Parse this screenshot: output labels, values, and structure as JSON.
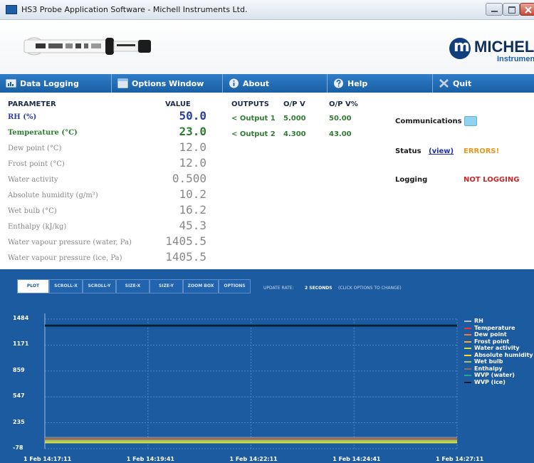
{
  "window": {
    "title": "HS3 Probe Application Software - Michell Instruments Ltd."
  },
  "brand": {
    "name": "MICHELL",
    "sub": "Instruments"
  },
  "menu": [
    {
      "label": "Data Logging",
      "icon": "data-logging-icon"
    },
    {
      "label": "Options Window",
      "icon": "options-window-icon"
    },
    {
      "label": "About",
      "icon": "info-icon"
    },
    {
      "label": "Help",
      "icon": "help-icon"
    },
    {
      "label": "Quit",
      "icon": "quit-icon"
    }
  ],
  "table": {
    "headers": {
      "parameter": "PARAMETER",
      "value": "VALUE",
      "outputs": "OUTPUTS",
      "opv": "O/P V",
      "opvp": "O/P V%"
    },
    "rows": [
      {
        "name": "RH (%)",
        "value": "50.0",
        "color": "#2a3f9e"
      },
      {
        "name": "Temperature (°C)",
        "value": "23.0",
        "color": "#2e7d32"
      },
      {
        "name": "Dew point (°C)",
        "value": "12.0",
        "color": "#888888"
      },
      {
        "name": "Frost point (°C)",
        "value": "12.0",
        "color": "#888888"
      },
      {
        "name": "Water activity",
        "value": "0.500",
        "color": "#888888"
      },
      {
        "name": "Absolute humidity (g/m³)",
        "value": "10.2",
        "color": "#888888"
      },
      {
        "name": "Wet bulb (°C)",
        "value": "16.2",
        "color": "#888888"
      },
      {
        "name": "Enthalpy (kJ/kg)",
        "value": "45.3",
        "color": "#888888"
      },
      {
        "name": "Water vapour pressure (water, Pa)",
        "value": "1405.5",
        "color": "#888888"
      },
      {
        "name": "Water vapour pressure (ice, Pa)",
        "value": "1405.5",
        "color": "#888888"
      }
    ],
    "outputs": [
      {
        "label": "< Output 1",
        "v": "5.000",
        "pct": "50.00"
      },
      {
        "label": "< Output 2",
        "v": "4.300",
        "pct": "43.00"
      }
    ]
  },
  "status": {
    "communications_label": "Communications",
    "status_label": "Status",
    "view_link": "(view)",
    "errors_text": "ERRORS!",
    "logging_label": "Logging",
    "logging_value": "NOT LOGGING",
    "comm_color": "#8fd3ef",
    "errors_color": "#e39a1f",
    "not_logging_color": "#c62828"
  },
  "plot_toolbar": {
    "buttons": [
      "PLOT",
      "SCROLL-X",
      "SCROLL-Y",
      "SIZE-X",
      "SIZE-Y",
      "ZOOM BOX",
      "OPTIONS"
    ],
    "active": "PLOT",
    "update_label": "UPDATE RATE:",
    "update_value": "2 SECONDS",
    "update_hint": "(CLICK OPTIONS TO CHANGE)"
  },
  "chart_data": {
    "type": "line",
    "x": [
      "1 Feb 14:17:11",
      "1 Feb 14:19:41",
      "1 Feb 14:22:11",
      "1 Feb 14:24:41",
      "1 Feb 14:27:11"
    ],
    "ylim": [
      -78,
      1484
    ],
    "yticks": [
      1484,
      1171,
      859,
      547,
      235,
      -78
    ],
    "grid": true,
    "legend_position": "right",
    "series": [
      {
        "name": "RH",
        "color": "#b0bec5",
        "values": [
          50.0,
          50.0,
          50.0,
          50.0,
          50.0
        ]
      },
      {
        "name": "Temperature",
        "color": "#e53935",
        "values": [
          23.0,
          23.0,
          23.0,
          23.0,
          23.0
        ]
      },
      {
        "name": "Dew point",
        "color": "#ff7043",
        "values": [
          12.0,
          12.0,
          12.0,
          12.0,
          12.0
        ]
      },
      {
        "name": "Frost point",
        "color": "#ffa726",
        "values": [
          12.0,
          12.0,
          12.0,
          12.0,
          12.0
        ]
      },
      {
        "name": "Water activity",
        "color": "#cddc39",
        "values": [
          0.5,
          0.5,
          0.5,
          0.5,
          0.5
        ]
      },
      {
        "name": "Absolute humidity",
        "color": "#fdd835",
        "values": [
          10.2,
          10.2,
          10.2,
          10.2,
          10.2
        ]
      },
      {
        "name": "Wet bulb",
        "color": "#9ccc65",
        "values": [
          16.2,
          16.2,
          16.2,
          16.2,
          16.2
        ]
      },
      {
        "name": "Enthalpy",
        "color": "#8d6e63",
        "values": [
          45.3,
          45.3,
          45.3,
          45.3,
          45.3
        ]
      },
      {
        "name": "WVP (water)",
        "color": "#26a69a",
        "values": [
          1405.5,
          1405.5,
          1405.5,
          1405.5,
          1405.5
        ]
      },
      {
        "name": "WVP (ice)",
        "color": "#0b1f3a",
        "values": [
          1405.5,
          1405.5,
          1405.5,
          1405.5,
          1405.5
        ]
      }
    ]
  }
}
